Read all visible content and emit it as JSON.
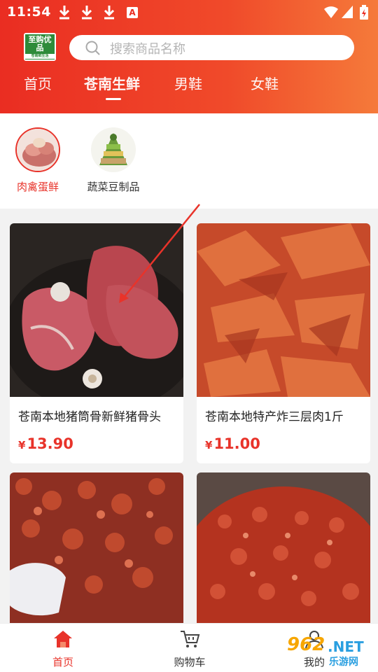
{
  "status_bar": {
    "time": "11:54"
  },
  "header": {
    "logo_text": "至购优品",
    "logo_subtext": "苍南鲜生活",
    "search_placeholder": "搜索商品名称",
    "tabs": [
      {
        "label": "首页",
        "active": false
      },
      {
        "label": "苍南生鲜",
        "active": true
      },
      {
        "label": "男鞋",
        "active": false
      },
      {
        "label": "女鞋",
        "active": false
      }
    ]
  },
  "categories": [
    {
      "label": "肉禽蛋鲜",
      "active": true
    },
    {
      "label": "蔬菜豆制品",
      "active": false
    }
  ],
  "products": [
    {
      "title": "苍南本地猪筒骨新鲜猪骨头",
      "price": "13.90",
      "currency": "¥"
    },
    {
      "title": "苍南本地特产炸三层肉1斤",
      "price": "11.00",
      "currency": "¥"
    },
    {
      "title": "",
      "price": "",
      "currency": ""
    },
    {
      "title": "",
      "price": "",
      "currency": ""
    }
  ],
  "bottom_nav": [
    {
      "label": "首页",
      "active": true,
      "icon": "home-icon"
    },
    {
      "label": "购物车",
      "active": false,
      "icon": "cart-icon"
    },
    {
      "label": "我的",
      "active": false,
      "icon": "user-icon"
    }
  ],
  "watermark": {
    "number": "962",
    "domain": ".NET",
    "site_name": "乐游网"
  },
  "colors": {
    "brand_red": "#e8332a",
    "header_start": "#ea2d22",
    "header_end": "#f57a3a"
  }
}
